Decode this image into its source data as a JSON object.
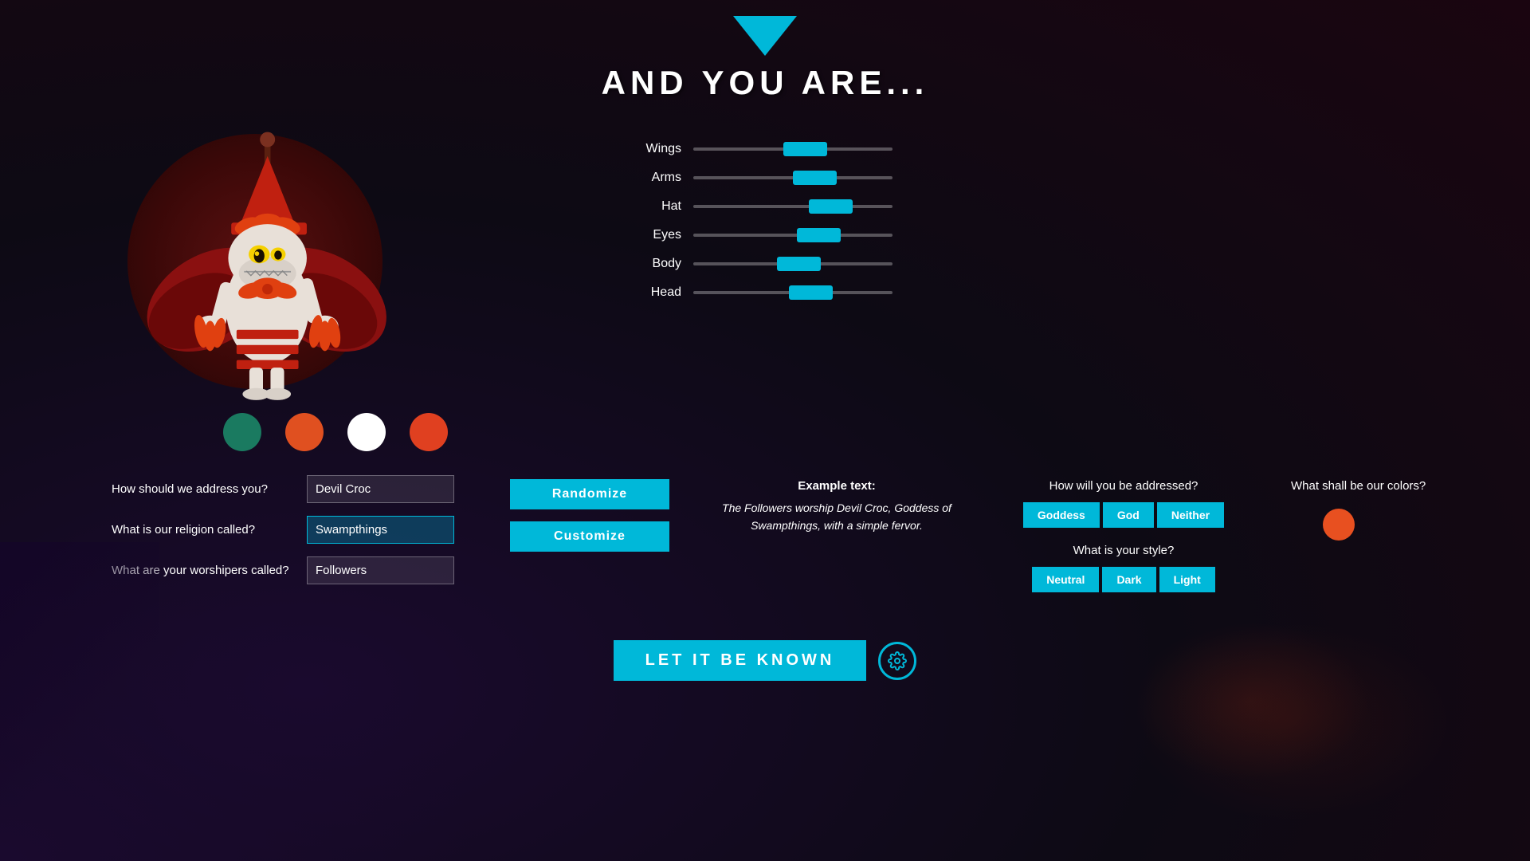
{
  "header": {
    "title": "AND YOU ARE...",
    "triangle_icon": "triangle-up"
  },
  "sliders": {
    "items": [
      {
        "label": "Wings",
        "position": 55
      },
      {
        "label": "Arms",
        "position": 60
      },
      {
        "label": "Hat",
        "position": 65
      },
      {
        "label": "Eyes",
        "position": 58
      },
      {
        "label": "Body",
        "position": 50
      },
      {
        "label": "Head",
        "position": 56
      }
    ]
  },
  "color_swatches": [
    {
      "color": "#1a7a60",
      "name": "teal"
    },
    {
      "color": "#e05020",
      "name": "orange-red"
    },
    {
      "color": "#ffffff",
      "name": "white"
    },
    {
      "color": "#e04020",
      "name": "red"
    }
  ],
  "form": {
    "name_label": "How should we address you?",
    "name_value": "Devil Croc",
    "religion_label": "What is our religion called?",
    "religion_value": "Swampthings",
    "worshipers_label": "What are your worshipers called?",
    "worshipers_value": "Followers"
  },
  "buttons": {
    "randomize": "Randomize",
    "customize": "Customize",
    "let_it_be_known": "LET IT BE KNOWN",
    "gear_icon": "gear"
  },
  "example": {
    "label": "Example text:",
    "text": "The Followers worship Devil Croc, Goddess of\nSwampthings, with a simple fervor."
  },
  "addressing": {
    "question": "How will you be addressed?",
    "options": [
      "Goddess",
      "God",
      "Neither"
    ],
    "selected": "Goddess"
  },
  "style": {
    "question": "What is your style?",
    "options": [
      "Neutral",
      "Dark",
      "Light"
    ],
    "selected": "Light"
  },
  "colors": {
    "question": "What shall be our colors?",
    "current_color": "#e85020"
  }
}
